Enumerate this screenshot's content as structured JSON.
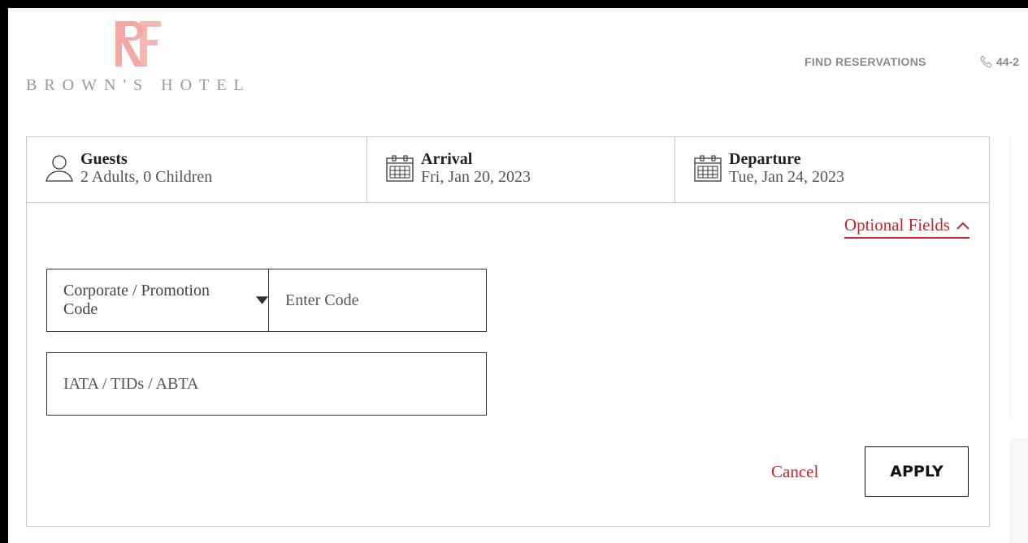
{
  "header": {
    "logo_monogram": "RF",
    "brand_name": "BROWN'S HOTEL",
    "nav": {
      "find_reservations": "FIND RESERVATIONS"
    },
    "phone_text": "44-2"
  },
  "booking": {
    "guests": {
      "title": "Guests",
      "value": "2 Adults, 0 Children"
    },
    "arrival": {
      "title": "Arrival",
      "value": "Fri, Jan 20, 2023"
    },
    "departure": {
      "title": "Departure",
      "value": "Tue, Jan 24, 2023"
    },
    "optional_fields_label": "Optional Fields",
    "promo_select_label": "Corporate / Promotion Code",
    "promo_code_placeholder": "Enter Code",
    "iata_placeholder": "IATA / TIDs / ABTA",
    "cancel_label": "Cancel",
    "apply_label": "APPLY"
  },
  "colors": {
    "accent": "#c4262e",
    "logo": "#f2a9a6",
    "muted": "#8a8a8a"
  },
  "icons": {
    "guests": "user-icon",
    "arrival": "calendar-icon",
    "departure": "calendar-icon",
    "toggle": "chevron-up-icon",
    "select": "caret-down-icon",
    "phone": "phone-icon"
  }
}
